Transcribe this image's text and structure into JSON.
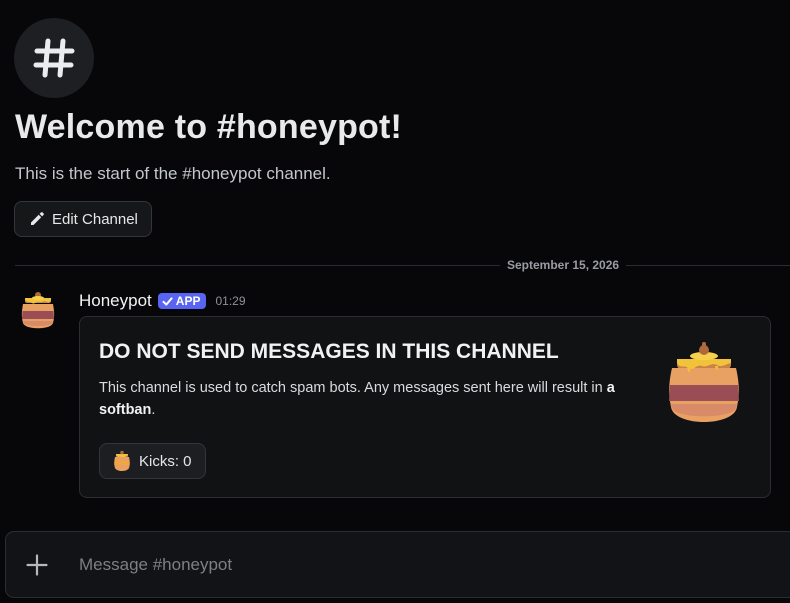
{
  "channel": {
    "icon": "hash-icon",
    "welcome_title": "Welcome to #honeypot!",
    "welcome_subtitle": "This is the start of the #honeypot channel.",
    "edit_button_label": "Edit Channel"
  },
  "date_divider": {
    "label": "September 15, 2026"
  },
  "message": {
    "author": "Honeypot",
    "badge": "APP",
    "timestamp": "01:29",
    "embed": {
      "title": "DO NOT SEND MESSAGES IN THIS CHANNEL",
      "description_prefix": "This channel is used to catch spam bots. Any messages sent here will result in ",
      "description_bold": "a softban",
      "description_suffix": ".",
      "thumbnail": "honey-pot-icon",
      "button_label": "Kicks: 0",
      "button_icon": "honey-pot-icon"
    }
  },
  "composer": {
    "placeholder": "Message #honeypot",
    "value": ""
  },
  "colors": {
    "background": "#070709",
    "badge": "#5865f2",
    "honey": "#f2c23a",
    "pot_top": "#e6a45a",
    "pot_band": "#9a4b55"
  }
}
